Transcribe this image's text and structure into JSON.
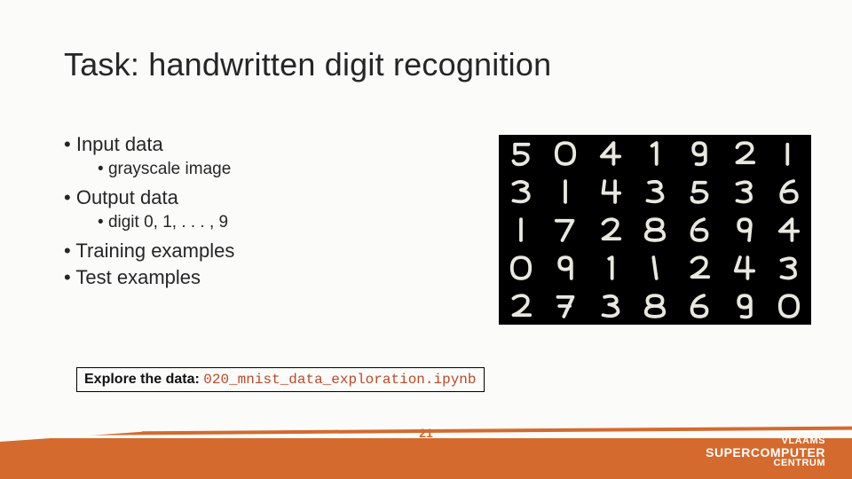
{
  "title": "Task: handwritten digit recognition",
  "bullets": {
    "input": "Input data",
    "input_sub": "grayscale image",
    "output": "Output data",
    "output_sub": "digit 0, 1, . . . , 9",
    "train": "Training examples",
    "test": "Test examples"
  },
  "explore": {
    "label": "Explore the data: ",
    "path": "020_mnist_data_exploration.ipynb"
  },
  "page_number": "21",
  "logo": {
    "line1": "VLAAMS",
    "line2": "SUPERCOMPUTER",
    "line3": "CENTRUM"
  },
  "grid_digits": [
    "5",
    "0",
    "4",
    "1",
    "9",
    "2",
    "1",
    "3",
    "1",
    "4",
    "3",
    "5",
    "3",
    "6",
    "1",
    "7",
    "2",
    "8",
    "6",
    "9",
    "4",
    "0",
    "9",
    "1",
    "1",
    "2",
    "4",
    "3",
    "2",
    "7",
    "3",
    "8",
    "6",
    "9",
    "0"
  ]
}
